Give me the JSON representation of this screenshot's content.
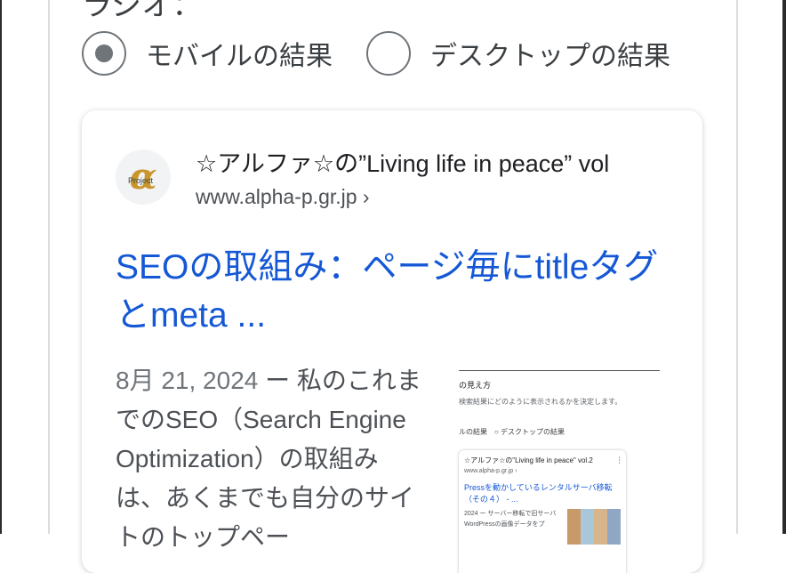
{
  "heading_partial": "ラジオ：",
  "options": [
    {
      "label": "モバイルの結果",
      "selected": true
    },
    {
      "label": "デスクトップの結果",
      "selected": false
    }
  ],
  "result": {
    "site_name": "☆アルファ☆の”Living life in peace” vol",
    "url": "www.alpha-p.gr.jp ›",
    "title": "SEOの取組み：ページ毎にtitleタグとmeta ...",
    "date": "8月 21, 2024",
    "snippet": " ー 私のこれまでのSEO（Search Engine Optimization）の取組みは、あくまでも自分のサイトのトップペー",
    "favicon_glyph": "α",
    "favicon_text": "Project"
  },
  "thumbnail": {
    "heading": "の見え方",
    "desc": "検索結果にどのように表示されるかを決定します。",
    "options": "ルの結果　○ デスクトップの結果",
    "site": "☆アルファ☆の\"Living life in peace\" vol.2",
    "url": "www.alpha-p.gr.jp ›",
    "title": "Pressを動かしているレンタルサーバ移転（その４） - ...",
    "snippet": "2024 ー サーバー移転で旧サーバWordPressの画像データをプ"
  }
}
